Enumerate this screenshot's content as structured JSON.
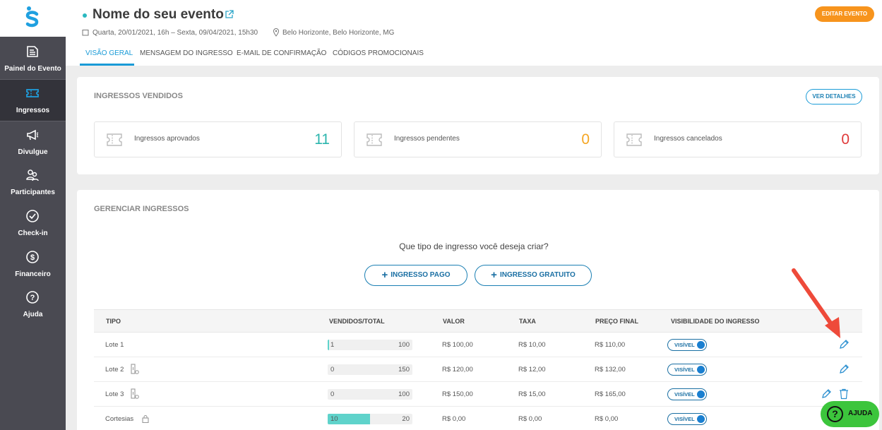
{
  "sidebar": {
    "logo": "S",
    "items": [
      {
        "label": "Painel do Evento",
        "icon": "document-icon"
      },
      {
        "label": "Ingressos",
        "icon": "ticket-icon"
      },
      {
        "label": "Divulgue",
        "icon": "megaphone-icon"
      },
      {
        "label": "Participantes",
        "icon": "users-icon"
      },
      {
        "label": "Check-in",
        "icon": "check-circle-icon"
      },
      {
        "label": "Financeiro",
        "icon": "dollar-circle-icon"
      },
      {
        "label": "Ajuda",
        "icon": "question-circle-icon"
      }
    ]
  },
  "header": {
    "title": "Nome do seu evento",
    "date": "Quarta, 20/01/2021, 16h – Sexta, 09/04/2021, 15h30",
    "location": "Belo Horizonte, Belo Horizonte, MG",
    "edit_button": "EDITAR EVENTO"
  },
  "tabs": [
    {
      "label": "VISÃO GERAL",
      "active": true
    },
    {
      "label": "MENSAGEM DO INGRESSO",
      "active": false
    },
    {
      "label": "E-MAIL DE CONFIRMAÇÃO",
      "active": false
    },
    {
      "label": "CÓDIGOS PROMOCIONAIS",
      "active": false
    }
  ],
  "sold": {
    "title": "INGRESSOS VENDIDOS",
    "details_button": "VER DETALHES",
    "stats": [
      {
        "label": "Ingressos aprovados",
        "value": "11",
        "color": "#2bb5ad"
      },
      {
        "label": "Ingressos pendentes",
        "value": "0",
        "color": "#f5a623"
      },
      {
        "label": "Ingressos cancelados",
        "value": "0",
        "color": "#e03a3a"
      }
    ]
  },
  "manage": {
    "title": "GERENCIAR INGRESSOS",
    "question": "Que tipo de ingresso você deseja criar?",
    "paid_button": "INGRESSO PAGO",
    "free_button": "INGRESSO GRATUITO",
    "columns": [
      "TIPO",
      "VENDIDOS/TOTAL",
      "VALOR",
      "TAXA",
      "PREÇO FINAL",
      "VISIBILIDADE DO INGRESSO"
    ],
    "rows": [
      {
        "tipo": "Lote 1",
        "sold": "1",
        "total": "100",
        "sold_fraction": 0.01,
        "valor": "R$ 100,00",
        "taxa": "R$ 10,00",
        "preco": "R$ 110,00",
        "visibility": "VISÍVEL",
        "extra_icon": "",
        "actions": [
          "edit"
        ]
      },
      {
        "tipo": "Lote 2",
        "sold": "0",
        "total": "150",
        "sold_fraction": 0,
        "valor": "R$ 120,00",
        "taxa": "R$ 12,00",
        "preco": "R$ 132,00",
        "visibility": "VISÍVEL",
        "extra_icon": "hourglass-icon",
        "actions": [
          "edit"
        ]
      },
      {
        "tipo": "Lote 3",
        "sold": "0",
        "total": "100",
        "sold_fraction": 0,
        "valor": "R$ 150,00",
        "taxa": "R$ 15,00",
        "preco": "R$ 165,00",
        "visibility": "VISÍVEL",
        "extra_icon": "hourglass-icon",
        "actions": [
          "edit",
          "delete"
        ]
      },
      {
        "tipo": "Cortesias",
        "sold": "10",
        "total": "20",
        "sold_fraction": 0.5,
        "valor": "R$ 0,00",
        "taxa": "R$ 0,00",
        "preco": "R$ 0,00",
        "visibility": "VISÍVEL",
        "extra_icon": "lock-icon",
        "actions": []
      }
    ]
  },
  "help_button": "AJUDA",
  "colors": {
    "accent": "#1a9bd7",
    "orange": "#f7941d",
    "sidebar": "#4a4a52",
    "teal": "#5fd3cb",
    "help_green": "#3cc53c"
  }
}
